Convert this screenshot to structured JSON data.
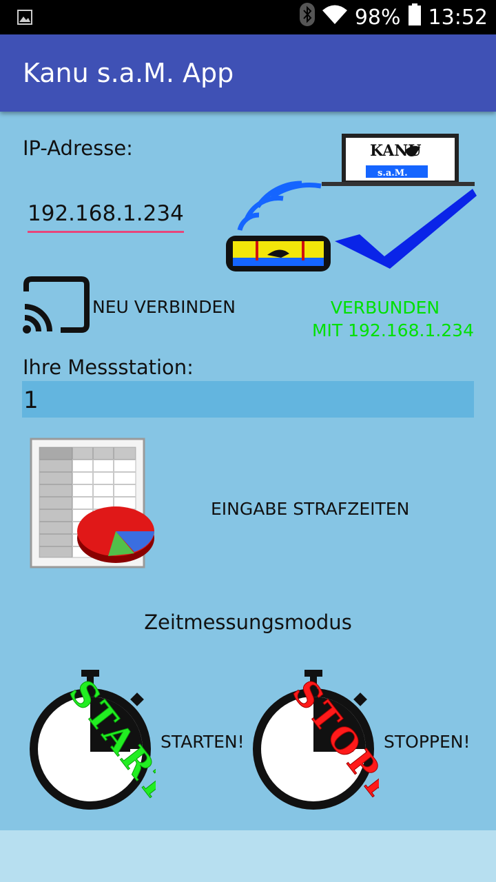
{
  "status_bar": {
    "icons": [
      "gallery-icon",
      "bluetooth-icon",
      "wifi-icon",
      "battery-icon"
    ],
    "battery": "98%",
    "time": "13:52"
  },
  "app_bar": {
    "title": "Kanu s.a.M. App"
  },
  "ip_section": {
    "label": "IP-Adresse:",
    "value": "192.168.1.234"
  },
  "logo": {
    "brand_top": "KANU",
    "brand_bottom": "s.a.M."
  },
  "connect": {
    "button_label": "NEU VERBINDEN",
    "status_line1": "VERBUNDEN",
    "status_line2": "MIT 192.168.1.234",
    "status_color": "#00e000"
  },
  "station": {
    "label": "Ihre Messstation:",
    "value": "1"
  },
  "penalty": {
    "label": "EINGABE STRAFZEITEN"
  },
  "timing": {
    "mode_label": "Zeitmessungsmodus",
    "start_stamp": "START",
    "start_label": "STARTEN!",
    "stop_stamp": "STOPP",
    "stop_label": "STOPPEN!"
  },
  "colors": {
    "app_bar": "#3f51b5",
    "background": "#86c5e4",
    "accent_underline": "#e8457a",
    "check_blue": "#0a24e8"
  }
}
